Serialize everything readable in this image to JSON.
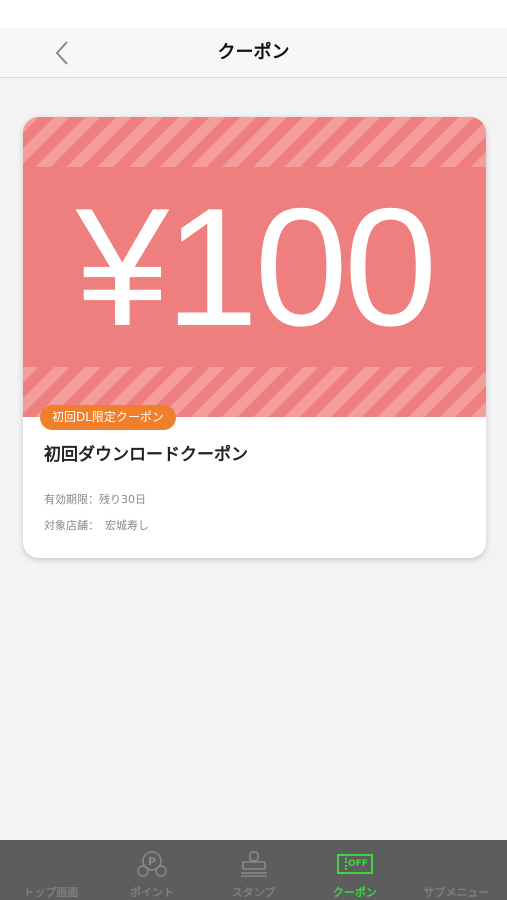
{
  "header": {
    "title": "クーポン"
  },
  "coupon": {
    "amount": "¥100",
    "badge": "初回DL限定クーポン",
    "title": "初回ダウンロードクーポン",
    "expiry_label": "有効期限：",
    "expiry_value": "残り30日",
    "store_label": "対象店舗：",
    "store_value": "宏城寿し"
  },
  "tabs": [
    {
      "label": "トップ画面",
      "icon": "home-icon",
      "active": false
    },
    {
      "label": "ポイント",
      "icon": "point-icon",
      "active": false
    },
    {
      "label": "スタンプ",
      "icon": "stamp-icon",
      "active": false
    },
    {
      "label": "クーポン",
      "icon": "coupon-off-icon",
      "active": true,
      "icon_text": "OFF"
    },
    {
      "label": "サブメニュー",
      "icon": "menu-icon",
      "active": false
    }
  ],
  "colors": {
    "banner": "#ef7e7e",
    "badge": "#ef7f2a",
    "active_tab": "#3fd63f",
    "tab_bar": "#5d5d5d"
  }
}
